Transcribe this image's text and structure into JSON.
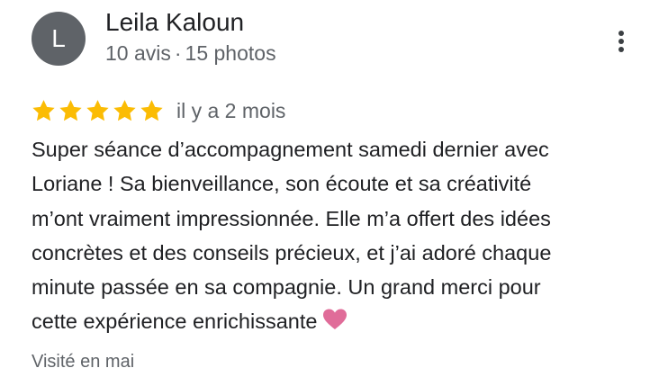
{
  "reviewer": {
    "initial": "L",
    "name": "Leila Kaloun",
    "review_count": "10 avis",
    "separator": "·",
    "photo_count": "15 photos",
    "avatar_color": "#5f6368"
  },
  "menu": {
    "icon": "more-vert-icon"
  },
  "review": {
    "rating": 5,
    "max_rating": 5,
    "star_color": "#fbbc04",
    "date": "il y a 2 mois",
    "text_lines": [
      "Super séance d’accompagnement samedi dernier avec",
      "Loriane ! Sa bienveillance, son écoute et sa créativité",
      "m’ont vraiment impressionnée. Elle m’a offert des idées",
      "concrètes et des conseils précieux, et j’ai adoré chaque",
      "minute passée en sa compagnie. Un grand merci pour",
      "cette expérience enrichissante"
    ],
    "emoji": "pink-heart-icon",
    "visited": "Visité en mai"
  }
}
